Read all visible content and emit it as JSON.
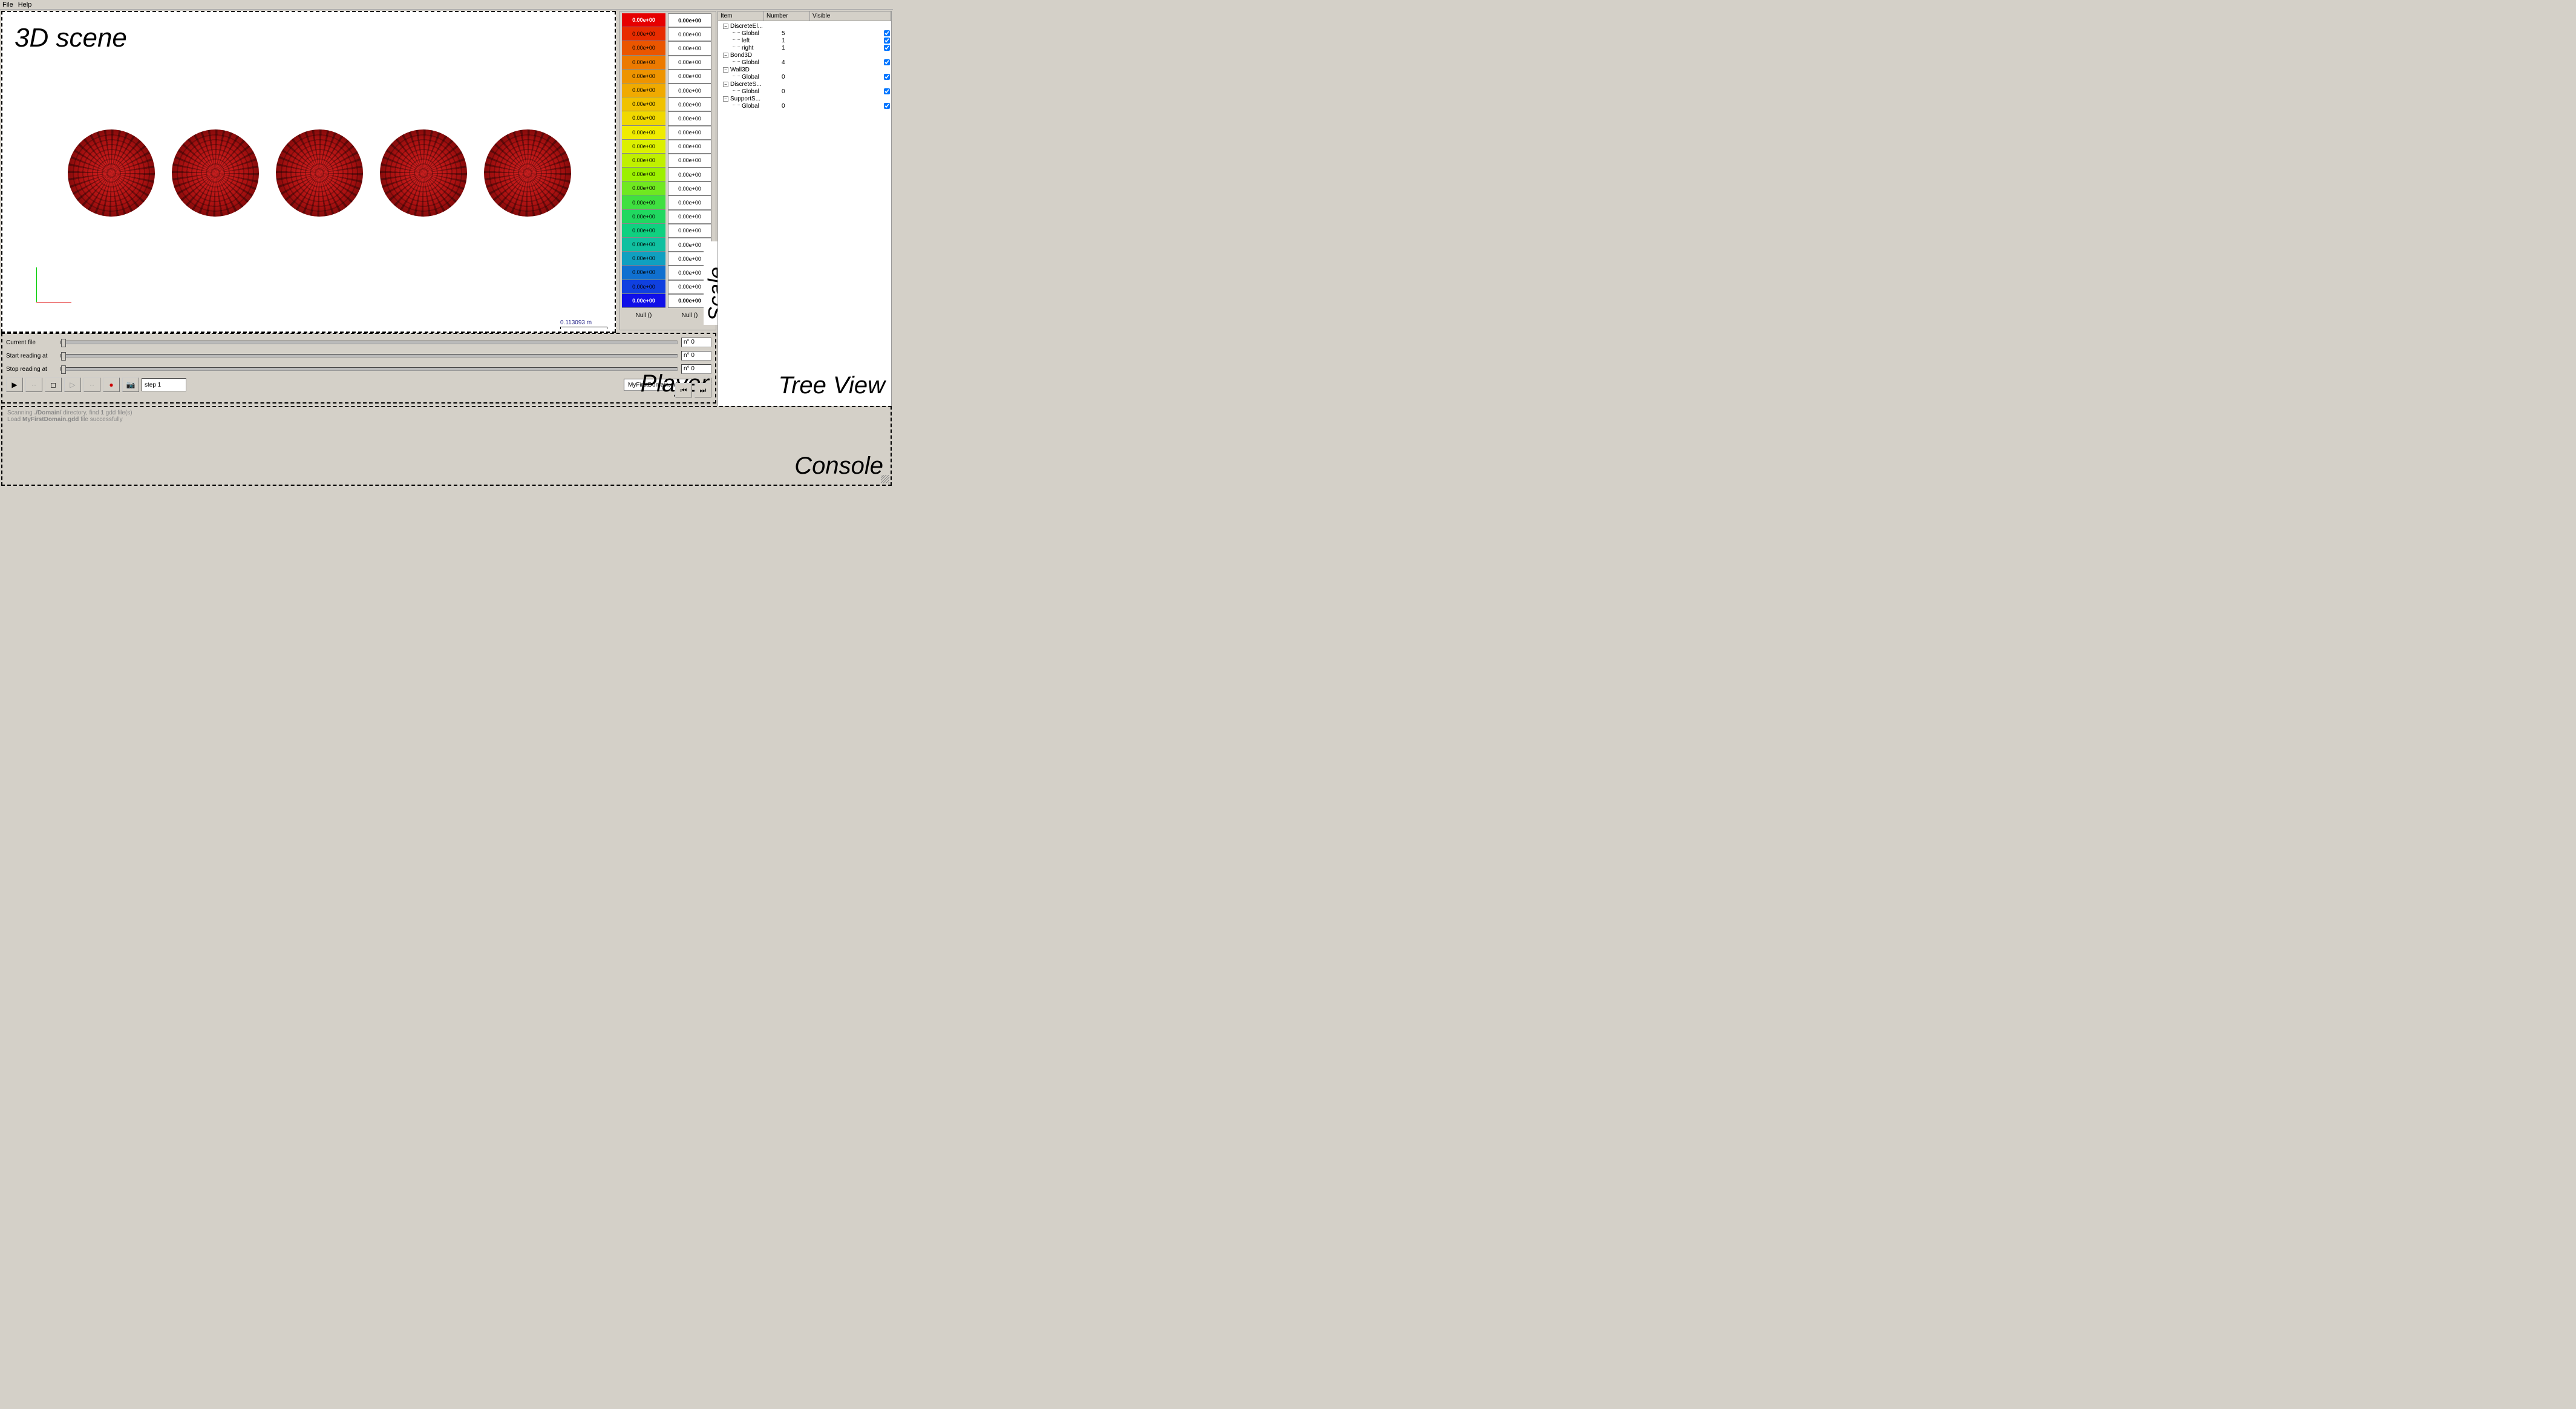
{
  "menu": {
    "file": "File",
    "help": "Help"
  },
  "scene": {
    "label": "3D scene",
    "scale_text": "0.113093 m",
    "scale_view_label": "Scale View"
  },
  "legend": {
    "colors": [
      {
        "c": "#e60000",
        "t": "0.00e+00",
        "bold": true,
        "fg": "#fff"
      },
      {
        "c": "#e82c00",
        "t": "0.00e+00"
      },
      {
        "c": "#ea5600",
        "t": "0.00e+00"
      },
      {
        "c": "#ec7a00",
        "t": "0.00e+00"
      },
      {
        "c": "#ee9400",
        "t": "0.00e+00"
      },
      {
        "c": "#f0aa00",
        "t": "0.00e+00"
      },
      {
        "c": "#f0c200",
        "t": "0.00e+00"
      },
      {
        "c": "#f0d800",
        "t": "0.00e+00"
      },
      {
        "c": "#f0ec00",
        "t": "0.00e+00"
      },
      {
        "c": "#dcf000",
        "t": "0.00e+00"
      },
      {
        "c": "#c0f000",
        "t": "0.00e+00"
      },
      {
        "c": "#9cf000",
        "t": "0.00e+00"
      },
      {
        "c": "#70e820",
        "t": "0.00e+00"
      },
      {
        "c": "#40e040",
        "t": "0.00e+00"
      },
      {
        "c": "#20d860",
        "t": "0.00e+00"
      },
      {
        "c": "#10d080",
        "t": "0.00e+00"
      },
      {
        "c": "#10c0a0",
        "t": "0.00e+00"
      },
      {
        "c": "#10a0c0",
        "t": "0.00e+00"
      },
      {
        "c": "#1070d0",
        "t": "0.00e+00"
      },
      {
        "c": "#1040e0",
        "t": "0.00e+00"
      },
      {
        "c": "#1010e8",
        "t": "0.00e+00",
        "bold": true,
        "fg": "#fff"
      }
    ],
    "label_default": "0.00e+00",
    "foot_left": "Null ()",
    "foot_right": "Null ()"
  },
  "tree": {
    "header": {
      "item": "Item",
      "number": "Number",
      "visible": "Visible"
    },
    "nodes": [
      {
        "label": "DiscreteEl...",
        "children": [
          {
            "label": "Global",
            "num": "5",
            "chk": true
          },
          {
            "label": "left",
            "num": "1",
            "chk": true
          },
          {
            "label": "right",
            "num": "1",
            "chk": true
          }
        ]
      },
      {
        "label": "Bond3D",
        "children": [
          {
            "label": "Global",
            "num": "4",
            "chk": true
          }
        ]
      },
      {
        "label": "Wall3D",
        "children": [
          {
            "label": "Global",
            "num": "0",
            "chk": true
          }
        ]
      },
      {
        "label": "DiscreteS...",
        "children": [
          {
            "label": "Global",
            "num": "0",
            "chk": true
          }
        ]
      },
      {
        "label": "SupportS...",
        "children": [
          {
            "label": "Global",
            "num": "0",
            "chk": true
          }
        ]
      }
    ],
    "label": "Tree View"
  },
  "player": {
    "label": "Player",
    "sliders": [
      {
        "label": "Current file",
        "val": "n° 0"
      },
      {
        "label": "Start reading at",
        "val": "n° 0"
      },
      {
        "label": "Stop reading at",
        "val": "n° 0"
      }
    ],
    "step": "step 1",
    "file": "MyFirstDomain.gdd"
  },
  "console": {
    "label": "Console",
    "line1a": "Scanning ",
    "line1b": "./Domain/",
    "line1c": " directory, find ",
    "line1d": "1",
    "line1e": " gdd file(s)",
    "line2a": "Load ",
    "line2b": "MyFirstDomain.gdd",
    "line2c": " file successfully"
  }
}
